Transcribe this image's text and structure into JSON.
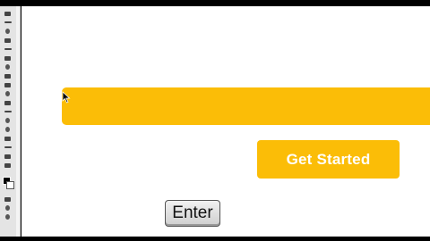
{
  "canvas": {
    "button_label": "Get Started",
    "accent_color": "#fbbd07",
    "background_color": "#ffffff"
  },
  "overlay": {
    "key_label": "Enter"
  },
  "toolbar": {
    "tools": [
      "move-tool-icon",
      "marquee-tool-icon",
      "lasso-tool-icon",
      "magic-wand-icon",
      "crop-tool-icon",
      "eyedropper-icon",
      "healing-brush-icon",
      "brush-tool-icon",
      "clone-stamp-icon",
      "history-brush-icon",
      "eraser-icon",
      "gradient-tool-icon",
      "blur-tool-icon",
      "dodge-tool-icon",
      "pen-tool-icon",
      "type-tool-icon",
      "path-selection-icon",
      "shape-tool-icon",
      "notes-tool-icon",
      "hand-tool-icon",
      "zoom-tool-icon"
    ]
  }
}
